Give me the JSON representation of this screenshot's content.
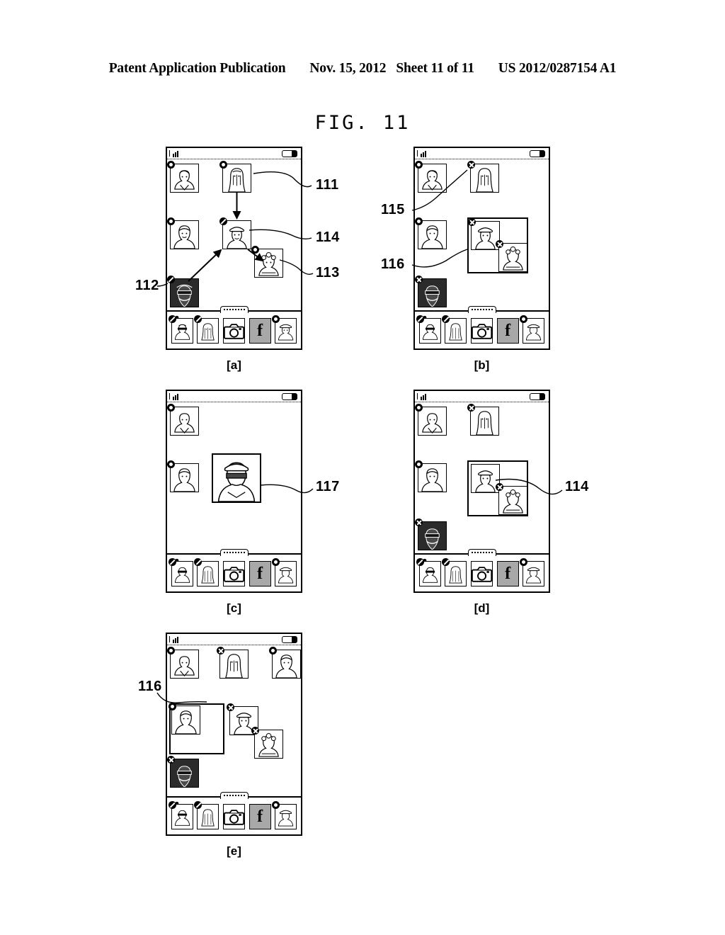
{
  "header": {
    "publication": "Patent Application Publication",
    "date": "Nov. 15, 2012",
    "sheet": "Sheet 11 of 11",
    "docnum": "US 2012/0287154 A1"
  },
  "figure": {
    "title": "FIG. 11",
    "panels": [
      {
        "id": "a",
        "label": "[a]",
        "refs": [
          "111",
          "112",
          "113",
          "114"
        ]
      },
      {
        "id": "b",
        "label": "[b]",
        "refs": [
          "115",
          "116"
        ]
      },
      {
        "id": "c",
        "label": "[c]",
        "refs": [
          "117"
        ]
      },
      {
        "id": "d",
        "label": "[d]",
        "refs": [
          "114"
        ]
      },
      {
        "id": "e",
        "label": "[e]",
        "refs": [
          "116"
        ]
      }
    ]
  },
  "refs": {
    "r111": "111",
    "r112": "112",
    "r113": "113",
    "r114_a": "114",
    "r115": "115",
    "r116_b": "116",
    "r117": "117",
    "r114_d": "114",
    "r116_e": "116"
  },
  "panel_labels": {
    "a": "[a]",
    "b": "[b]",
    "c": "[c]",
    "d": "[d]",
    "e": "[e]"
  },
  "dock": {
    "items": [
      {
        "name": "contact-avatar-1",
        "icon": "avatar-man-glasses",
        "badge": "slash"
      },
      {
        "name": "contact-avatar-2",
        "icon": "avatar-long-hair-woman",
        "badge": "slash"
      },
      {
        "name": "camera-button",
        "icon": "camera-icon",
        "badge": "none"
      },
      {
        "name": "facebook-button",
        "icon": "facebook-f-icon",
        "label": "f",
        "badge": "none",
        "highlighted": true
      },
      {
        "name": "contact-avatar-3",
        "icon": "avatar-man-cap",
        "badge": "dot"
      }
    ],
    "favorite_icon": "heart-icon",
    "facebook_label": "f"
  },
  "statusbar": {
    "signal_icon": "signal-bars-icon",
    "battery_icon": "battery-icon"
  },
  "colors": {
    "ink": "#000000",
    "paper": "#ffffff",
    "dock_highlight": "#a8a8a8",
    "dark_thumb": "#1a1a1a"
  }
}
